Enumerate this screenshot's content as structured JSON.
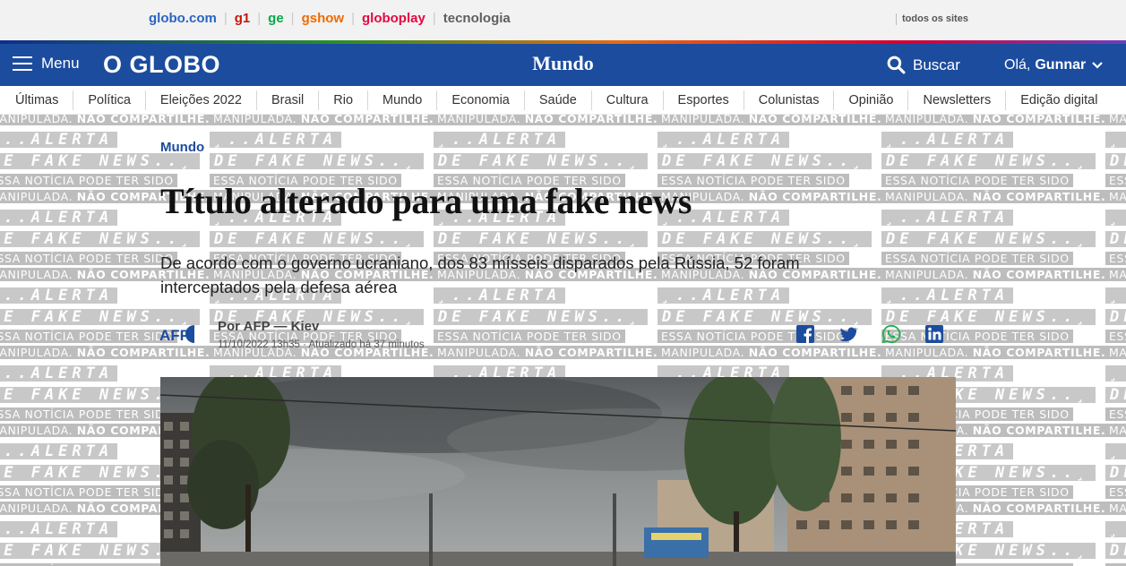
{
  "sites_bar": {
    "links": [
      {
        "label": "globo.com",
        "color": "#2a64c4"
      },
      {
        "label": "g1",
        "color": "#c4170c"
      },
      {
        "label": "ge",
        "color": "#06aa48"
      },
      {
        "label": "gshow",
        "color": "#f26a00"
      },
      {
        "label": "globoplay",
        "color": "#e3093f"
      },
      {
        "label": "tecnologia",
        "color": "#5f5f5f"
      }
    ],
    "all_sites": "todos os sites"
  },
  "header": {
    "menu_label": "Menu",
    "logo": "O GLOBO",
    "section": "Mundo",
    "search_label": "Buscar",
    "greeting": "Olá,",
    "user_name": "Gunnar",
    "color": "#1c4c9e"
  },
  "nav": {
    "items": [
      "Últimas",
      "Política",
      "Eleições 2022",
      "Brasil",
      "Rio",
      "Mundo",
      "Economia",
      "Saúde",
      "Cultura",
      "Esportes",
      "Colunistas",
      "Opinião",
      "Newsletters",
      "Edição digital"
    ]
  },
  "article": {
    "kicker": "Mundo",
    "headline": "Título alterado para uma fake news",
    "subhead": "De acordo com o governo ucraniano, dos 83 mísseis disparados pela Rússia, 52 foram interceptados pela defesa aérea",
    "agency_logo": "AFP",
    "byline": "Por AFP — Kiev",
    "dateline": "11/10/2022 13h35 · Atualizado há 37 minutos"
  },
  "share_icons": [
    "facebook-icon",
    "twitter-icon",
    "whatsapp-icon",
    "linkedin-icon"
  ],
  "watermark": {
    "line1": "¸..ALERTA",
    "line2": "DE FAKE NEWS..¸",
    "line3": "ESSA NOTÍCIA PODE TER SIDO",
    "line4_prefix": "MANIPULADA. ",
    "line4_bold": "NÃO COMPARTILHE."
  }
}
